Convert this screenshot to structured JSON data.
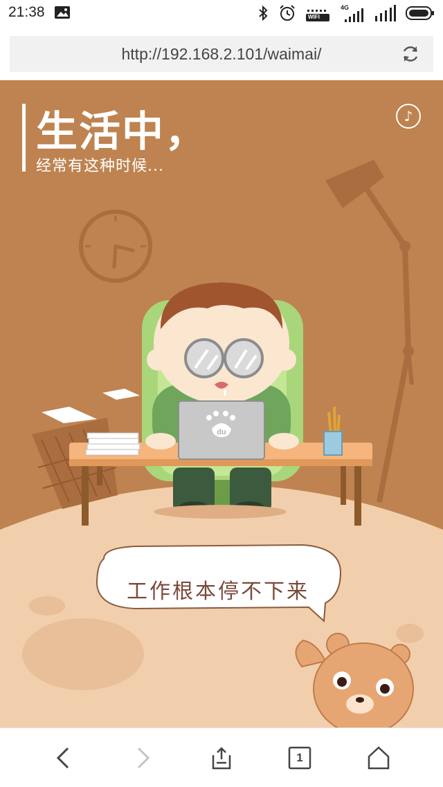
{
  "status_bar": {
    "time": "21:38",
    "icons": [
      "image-icon",
      "bluetooth-icon",
      "alarm-icon",
      "wifi-icon",
      "signal-4g-icon",
      "signal-icon",
      "battery-icon"
    ],
    "network_label": "4G",
    "wifi_label": "WIFI"
  },
  "browser": {
    "url": "http://192.168.2.101/waimai/"
  },
  "page": {
    "headline": "生活中，",
    "subline": "经常有这种时候...",
    "bubble_text": "工作根本停不下来",
    "laptop_logo": "du"
  },
  "toolbar": {
    "tab_count": "1",
    "buttons": [
      "back-icon",
      "forward-icon",
      "share-icon",
      "tabs-icon",
      "home-icon"
    ]
  },
  "colors": {
    "background": "#be8350",
    "floor": "#f2cfac",
    "accent": "#ffffff"
  }
}
